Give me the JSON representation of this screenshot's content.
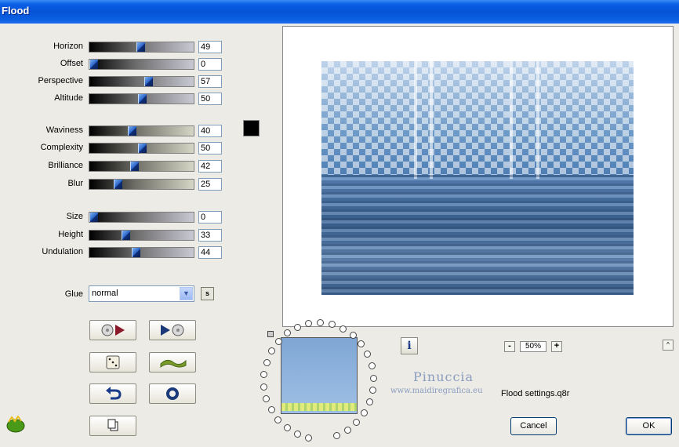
{
  "window": {
    "title": "Flood"
  },
  "sliders": [
    {
      "label": "Horizon",
      "value": "49",
      "level": 49,
      "style": "gray"
    },
    {
      "label": "Offset",
      "value": "0",
      "level": 0,
      "style": "gray"
    },
    {
      "label": "Perspective",
      "value": "57",
      "level": 57,
      "style": "gray"
    },
    {
      "label": "Altitude",
      "value": "50",
      "level": 50,
      "style": "gray"
    },
    {
      "label": "Waviness",
      "value": "40",
      "level": 40,
      "style": "warm"
    },
    {
      "label": "Complexity",
      "value": "50",
      "level": 50,
      "style": "warm"
    },
    {
      "label": "Brilliance",
      "value": "42",
      "level": 42,
      "style": "warm"
    },
    {
      "label": "Blur",
      "value": "25",
      "level": 25,
      "style": "warm"
    },
    {
      "label": "Size",
      "value": "0",
      "level": 0,
      "style": "gray"
    },
    {
      "label": "Height",
      "value": "33",
      "level": 33,
      "style": "gray"
    },
    {
      "label": "Undulation",
      "value": "44",
      "level": 44,
      "style": "gray"
    }
  ],
  "color_swatch": "#000000",
  "glue": {
    "label": "Glue",
    "value": "normal",
    "s_button": "s"
  },
  "zoom": {
    "value": "50%",
    "minus": "-",
    "plus": "+"
  },
  "info_label": "i",
  "up_label": "^",
  "watermark": {
    "name": "Pinuccia",
    "url": "www.maidiregrafica.eu"
  },
  "settings_file": "Flood settings.q8r",
  "buttons": {
    "cancel": "Cancel",
    "ok": "OK"
  },
  "icons": [
    "load-preset-icon",
    "save-preset-icon",
    "random-dice-icon",
    "wave-icon",
    "undo-icon",
    "reset-circle-icon",
    "copy-icon"
  ]
}
